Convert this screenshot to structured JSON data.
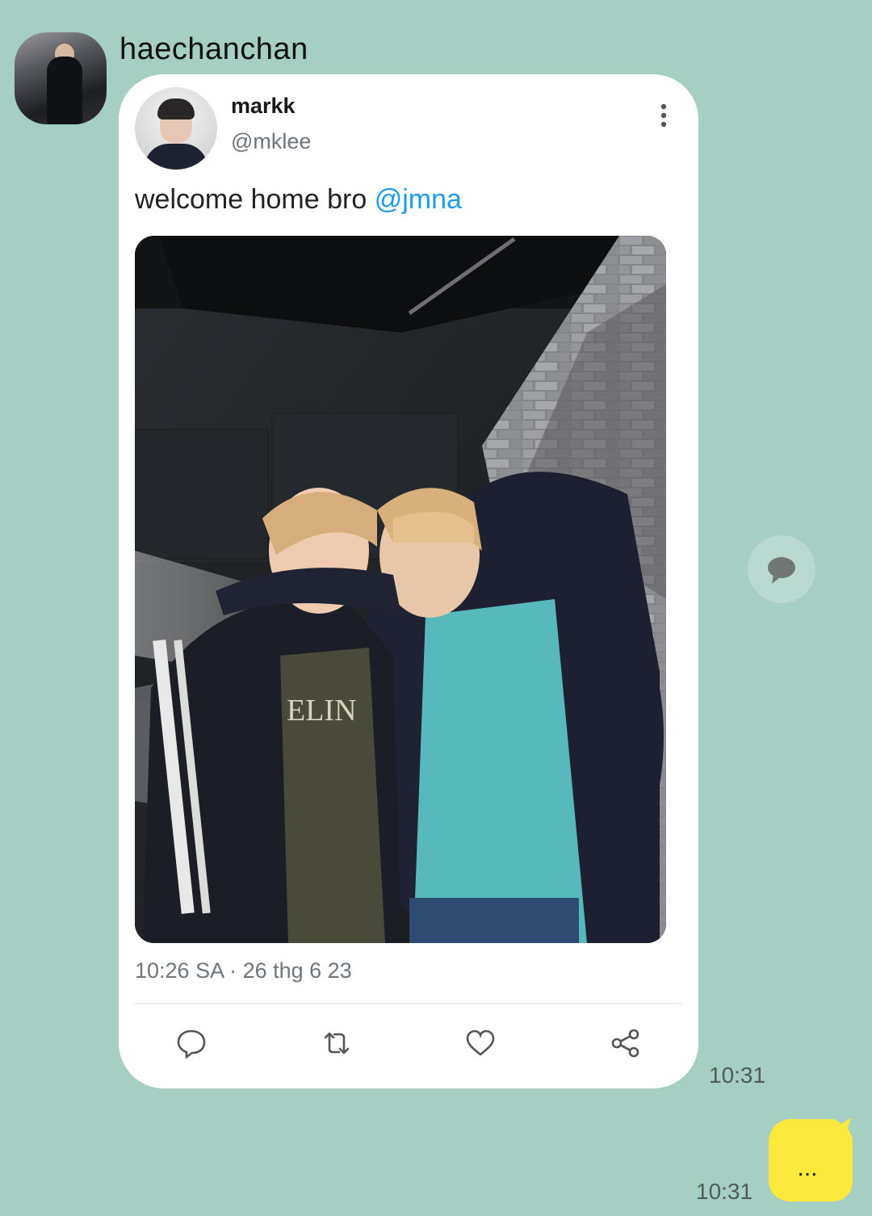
{
  "chat": {
    "sender_name": "haechanchan",
    "sender_avatar": "sender-avatar",
    "received_time": "10:31",
    "sent_time": "10:31",
    "sent_message": "...",
    "colors": {
      "background": "#a4cfc2",
      "my_bubble": "#fde93c",
      "mention": "#1d9bf0"
    }
  },
  "tweet": {
    "name": "markk",
    "handle": "@mklee",
    "text": "welcome home bro ",
    "mention": "@jmna",
    "timestamp": "10:26 SA · 26 thg 6 23",
    "photo_shirt_text": "ELIN",
    "actions": [
      "reply-icon",
      "retweet-icon",
      "like-icon",
      "share-icon"
    ]
  }
}
